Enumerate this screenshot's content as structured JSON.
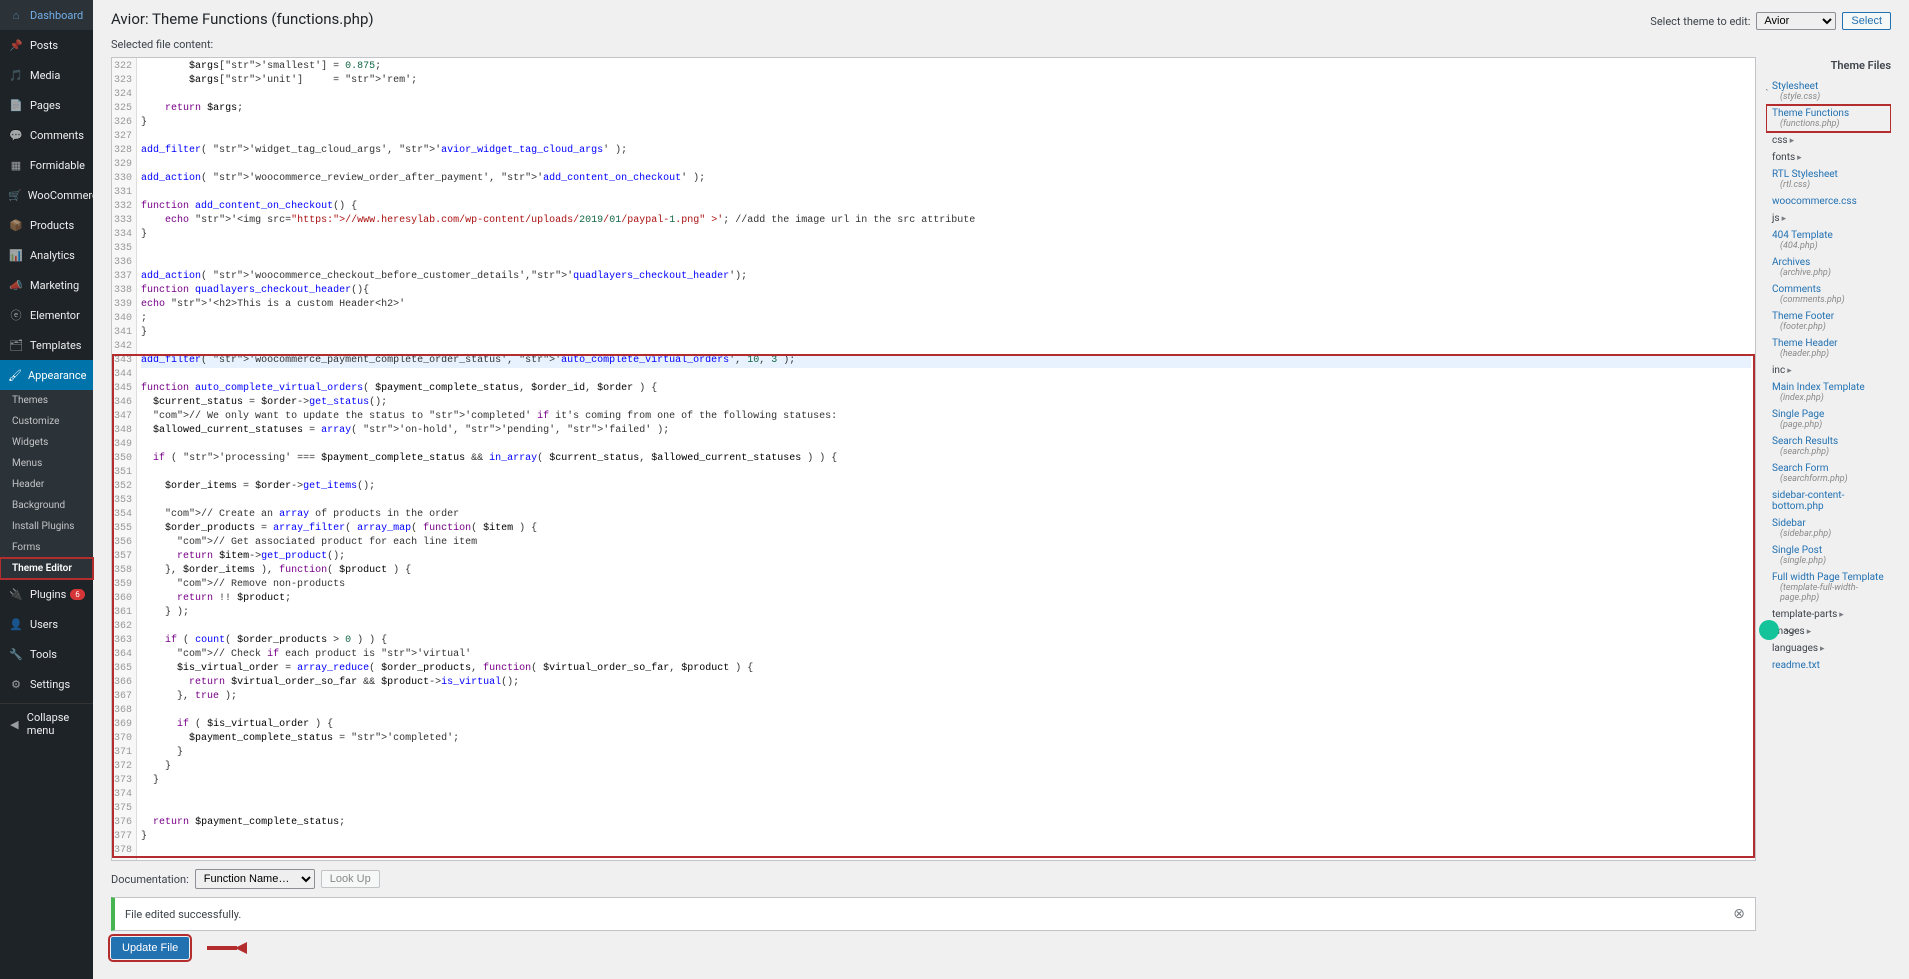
{
  "sidebar": {
    "items": [
      {
        "label": "Dashboard",
        "icon": "dashboard"
      },
      {
        "label": "Posts",
        "icon": "pin"
      },
      {
        "label": "Media",
        "icon": "media"
      },
      {
        "label": "Pages",
        "icon": "pages"
      },
      {
        "label": "Comments",
        "icon": "comments"
      },
      {
        "label": "Formidable",
        "icon": "formidable"
      },
      {
        "label": "WooCommerce",
        "icon": "woo"
      },
      {
        "label": "Products",
        "icon": "products"
      },
      {
        "label": "Analytics",
        "icon": "analytics"
      },
      {
        "label": "Marketing",
        "icon": "marketing"
      },
      {
        "label": "Elementor",
        "icon": "elementor"
      },
      {
        "label": "Templates",
        "icon": "templates"
      },
      {
        "label": "Appearance",
        "icon": "appearance",
        "open": true
      },
      {
        "label": "Plugins",
        "icon": "plugins",
        "badge": "6"
      },
      {
        "label": "Users",
        "icon": "users"
      },
      {
        "label": "Tools",
        "icon": "tools"
      },
      {
        "label": "Settings",
        "icon": "settings"
      }
    ],
    "submenu": [
      "Themes",
      "Customize",
      "Widgets",
      "Menus",
      "Header",
      "Background",
      "Install Plugins",
      "Forms",
      "Theme Editor"
    ],
    "collapse": "Collapse menu"
  },
  "header": {
    "title": "Avior: Theme Functions (functions.php)",
    "select_label": "Select theme to edit:",
    "theme_selected": "Avior",
    "select_btn": "Select"
  },
  "file_label": "Selected file content:",
  "code_lines": [
    {
      "n": 322,
      "t": "        $args['smallest'] = 0.875;"
    },
    {
      "n": 323,
      "t": "        $args['unit']     = 'rem';"
    },
    {
      "n": 324,
      "t": ""
    },
    {
      "n": 325,
      "t": "    return $args;"
    },
    {
      "n": 326,
      "t": "}"
    },
    {
      "n": 327,
      "t": ""
    },
    {
      "n": 328,
      "t": "add_filter( 'widget_tag_cloud_args', 'avior_widget_tag_cloud_args' );"
    },
    {
      "n": 329,
      "t": ""
    },
    {
      "n": 330,
      "t": "add_action( 'woocommerce_review_order_after_payment', 'add_content_on_checkout' );"
    },
    {
      "n": 331,
      "t": ""
    },
    {
      "n": 332,
      "t": "function add_content_on_checkout() {"
    },
    {
      "n": 333,
      "t": "    echo '<img src=\"https://www.heresylab.com/wp-content/uploads/2019/01/paypal-1.png\" >'; //add the image url in the src attribute"
    },
    {
      "n": 334,
      "t": "}"
    },
    {
      "n": 335,
      "t": ""
    },
    {
      "n": 336,
      "t": ""
    },
    {
      "n": 337,
      "t": "add_action( 'woocommerce_checkout_before_customer_details','quadlayers_checkout_header');"
    },
    {
      "n": 338,
      "t": "function quadlayers_checkout_header(){"
    },
    {
      "n": 339,
      "t": "echo '<h2>This is a custom Header<h2>'"
    },
    {
      "n": 340,
      "t": ";"
    },
    {
      "n": 341,
      "t": "}"
    },
    {
      "n": 342,
      "t": ""
    },
    {
      "n": 343,
      "t": "add_filter( 'woocommerce_payment_complete_order_status', 'auto_complete_virtual_orders', 10, 3 );",
      "hl": true
    },
    {
      "n": 344,
      "t": ""
    },
    {
      "n": 345,
      "t": "function auto_complete_virtual_orders( $payment_complete_status, $order_id, $order ) {"
    },
    {
      "n": 346,
      "t": "  $current_status = $order->get_status();"
    },
    {
      "n": 347,
      "t": "  // We only want to update the status to 'completed' if it's coming from one of the following statuses:"
    },
    {
      "n": 348,
      "t": "  $allowed_current_statuses = array( 'on-hold', 'pending', 'failed' );"
    },
    {
      "n": 349,
      "t": ""
    },
    {
      "n": 350,
      "t": "  if ( 'processing' === $payment_complete_status && in_array( $current_status, $allowed_current_statuses ) ) {"
    },
    {
      "n": 351,
      "t": ""
    },
    {
      "n": 352,
      "t": "    $order_items = $order->get_items();"
    },
    {
      "n": 353,
      "t": ""
    },
    {
      "n": 354,
      "t": "    // Create an array of products in the order"
    },
    {
      "n": 355,
      "t": "    $order_products = array_filter( array_map( function( $item ) {"
    },
    {
      "n": 356,
      "t": "      // Get associated product for each line item"
    },
    {
      "n": 357,
      "t": "      return $item->get_product();"
    },
    {
      "n": 358,
      "t": "    }, $order_items ), function( $product ) {"
    },
    {
      "n": 359,
      "t": "      // Remove non-products"
    },
    {
      "n": 360,
      "t": "      return !! $product;"
    },
    {
      "n": 361,
      "t": "    } );"
    },
    {
      "n": 362,
      "t": ""
    },
    {
      "n": 363,
      "t": "    if ( count( $order_products > 0 ) ) {"
    },
    {
      "n": 364,
      "t": "      // Check if each product is 'virtual'"
    },
    {
      "n": 365,
      "t": "      $is_virtual_order = array_reduce( $order_products, function( $virtual_order_so_far, $product ) {"
    },
    {
      "n": 366,
      "t": "        return $virtual_order_so_far && $product->is_virtual();"
    },
    {
      "n": 367,
      "t": "      }, true );"
    },
    {
      "n": 368,
      "t": ""
    },
    {
      "n": 369,
      "t": "      if ( $is_virtual_order ) {"
    },
    {
      "n": 370,
      "t": "        $payment_complete_status = 'completed';"
    },
    {
      "n": 371,
      "t": "      }"
    },
    {
      "n": 372,
      "t": "    }"
    },
    {
      "n": 373,
      "t": "  }"
    },
    {
      "n": 374,
      "t": "  "
    },
    {
      "n": 375,
      "t": ""
    },
    {
      "n": 376,
      "t": "  return $payment_complete_status;"
    },
    {
      "n": 377,
      "t": "}"
    },
    {
      "n": 378,
      "t": ""
    }
  ],
  "docs": {
    "label": "Documentation:",
    "select_placeholder": "Function Name…",
    "lookup": "Look Up"
  },
  "notice": {
    "text": "File edited successfully."
  },
  "update_btn": "Update File",
  "tree": {
    "title": "Theme Files",
    "items": [
      {
        "label": "Stylesheet",
        "sub": "(style.css)"
      },
      {
        "label": "Theme Functions",
        "sub": "(functions.php)",
        "active": true
      },
      {
        "label": "css",
        "folder": true
      },
      {
        "label": "fonts",
        "folder": true
      },
      {
        "label": "RTL Stylesheet",
        "sub": "(rtl.css)"
      },
      {
        "label": "woocommerce.css"
      },
      {
        "label": "js",
        "folder": true
      },
      {
        "label": "404 Template",
        "sub": "(404.php)"
      },
      {
        "label": "Archives",
        "sub": "(archive.php)"
      },
      {
        "label": "Comments",
        "sub": "(comments.php)"
      },
      {
        "label": "Theme Footer",
        "sub": "(footer.php)"
      },
      {
        "label": "Theme Header",
        "sub": "(header.php)"
      },
      {
        "label": "inc",
        "folder": true
      },
      {
        "label": "Main Index Template",
        "sub": "(index.php)"
      },
      {
        "label": "Single Page",
        "sub": "(page.php)"
      },
      {
        "label": "Search Results",
        "sub": "(search.php)"
      },
      {
        "label": "Search Form",
        "sub": "(searchform.php)"
      },
      {
        "label": "sidebar-content-bottom.php"
      },
      {
        "label": "Sidebar",
        "sub": "(sidebar.php)"
      },
      {
        "label": "Single Post",
        "sub": "(single.php)"
      },
      {
        "label": "Full width Page Template",
        "sub": "(template-full-width-page.php)"
      },
      {
        "label": "template-parts",
        "folder": true
      },
      {
        "label": "images",
        "folder": true
      },
      {
        "label": "languages",
        "folder": true
      },
      {
        "label": "readme.txt"
      }
    ]
  }
}
